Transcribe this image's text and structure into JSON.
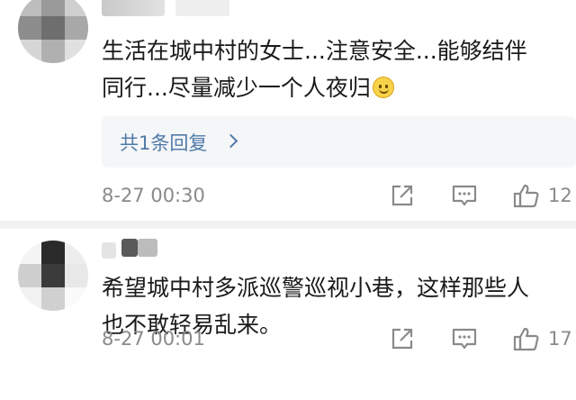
{
  "comments": [
    {
      "username": "",
      "text_line1": "生活在城中村的女士...注意安全...能够结伴",
      "text_line2": "同行...尽量减少一个人夜归",
      "emoji": "smile-emoji",
      "reply_link": "共1条回复",
      "time": "8-27 00:30",
      "likes": "12"
    },
    {
      "username": "",
      "text_line1": "希望城中村多派巡警巡视小巷，这样那些人",
      "text_line2": "也不敢轻易乱来。",
      "time": "8-27 00:01",
      "likes": "17"
    }
  ],
  "colors": {
    "link": "#507aa8",
    "meta_text": "#8a8a8a",
    "reply_bg": "#f5f6f8",
    "separator": "#f2f2f2"
  },
  "icons": [
    "share-icon",
    "comment-icon",
    "like-icon",
    "chevron-right-icon"
  ]
}
